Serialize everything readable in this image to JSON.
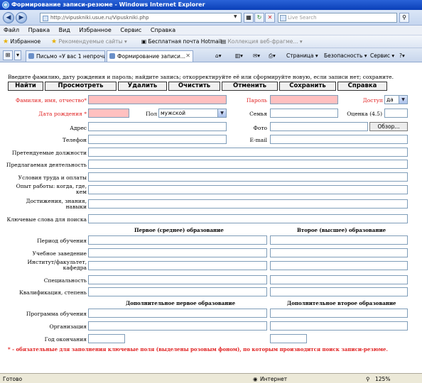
{
  "window": {
    "title": "Формирование записи-резюме - Windows Internet Explorer"
  },
  "address": {
    "url": "http://vipuskniki.usue.ru/Vipuskniki.php",
    "search_placeholder": "Live Search"
  },
  "menu": [
    "Файл",
    "Правка",
    "Вид",
    "Избранное",
    "Сервис",
    "Справка"
  ],
  "favorites": {
    "label": "Избранное",
    "items": [
      "Рекомендуемые сайты ▾",
      "Бесплатная почта Hotmail",
      "Коллекция веб-фрагме... ▾"
    ]
  },
  "tabs": [
    "Письмо «У вас 1 непрочи...",
    "Формирование записи..."
  ],
  "commands": [
    "Страница ▾",
    "Безопасность ▾",
    "Сервис ▾"
  ],
  "page": {
    "instruction": "Введите фамилию, дату рождения и пароль; найдите запись; откорректируйте её или сформируйте новую, если записи нет; сохраните.",
    "buttons": {
      "find": "Найти",
      "view": "Просмотреть",
      "delete": "Удалить",
      "clear": "Очистить",
      "cancel": "Отменить",
      "save": "Сохранить",
      "help": "Справка"
    },
    "labels": {
      "fio": "Фамилия, имя, отчество*",
      "password": "Пароль",
      "access": "Доступ",
      "birthdate": "Дата рождения *",
      "gender": "Пол",
      "family": "Семья",
      "grade": "Оценка (4.5)",
      "address": "Адрес",
      "photo": "Фото",
      "phone": "Телефон",
      "email": "E-mail",
      "positions": "Претендуемые должности",
      "activity": "Предлагаемая деятельность",
      "conditions": "Условия труда и оплаты",
      "experience": "Опыт работы: когда, где, кем",
      "achievements": "Достижения, знания, навыки",
      "keywords": "Ключевые слова для поиска",
      "period": "Период обучения",
      "institution": "Учебное заведение",
      "faculty": "Институт/факультет, кафедра",
      "specialty": "Специальность",
      "qualification": "Квалификация, степень",
      "program": "Программа обучения",
      "organization": "Организация",
      "end_year": "Год окончания"
    },
    "headers": {
      "first_edu": "Первое (среднее) образование",
      "second_edu": "Второе (высшее) образование",
      "add_first": "Дополнительное первое образование",
      "add_second": "Дополнительное второе образование"
    },
    "values": {
      "access": "да",
      "gender": "мужской"
    },
    "browse": "Обзор...",
    "note": "* - обязательные для заполнения ключевые поля (выделены розовым фоном), по которым производится поиск записи-резюме."
  },
  "status": {
    "text": "Готово",
    "zone": "Интернет",
    "zoom": "125%"
  }
}
